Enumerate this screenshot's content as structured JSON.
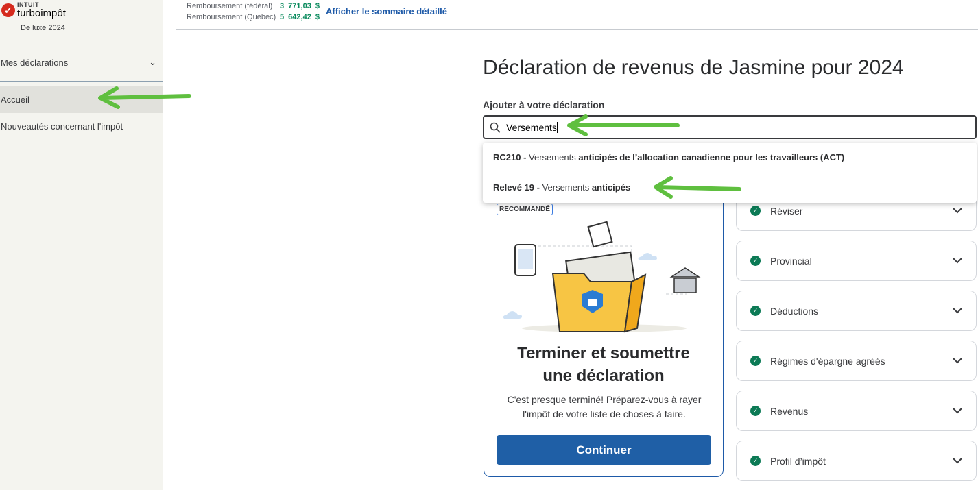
{
  "sidebar": {
    "logo_intuit": "INTUIT",
    "logo_brand": "turboimpôt",
    "edition": "De luxe 2024",
    "returns_menu": "Mes déclarations",
    "items": [
      {
        "label": "Accueil",
        "active": true
      },
      {
        "label": "Nouveautés concernant l'impôt"
      }
    ]
  },
  "header": {
    "refunds": [
      {
        "label": "Remboursement (fédéral)",
        "amount": "3 771,03 $"
      },
      {
        "label": "Remboursement (Québec)",
        "amount": "5 642,42 $"
      }
    ],
    "summary_link": "Afficher le sommaire détaillé"
  },
  "main": {
    "title": "Déclaration de revenus de Jasmine pour 2024",
    "add_label": "Ajouter à votre déclaration",
    "search_value": "Versements",
    "suggestions": [
      {
        "code": "RC210 -",
        "plain": "Versements",
        "bold": "anticipés de l’allocation canadienne pour les travailleurs (ACT)"
      },
      {
        "code": "Relevé 19 -",
        "plain": "Versements",
        "bold": "anticipés"
      }
    ],
    "card": {
      "badge": "RECOMMANDÉ",
      "title": "Terminer et soumettre une déclaration",
      "description": "C'est presque terminé! Préparez-vous à rayer l'impôt de votre liste de choses à faire.",
      "button": "Continuer"
    },
    "sections": [
      "Réviser",
      "Provincial",
      "Déductions",
      "Régimes d'épargne agréés",
      "Revenus",
      "Profil d’impôt"
    ]
  },
  "colors": {
    "accent": "#1f5fa6",
    "success": "#0b7a55",
    "annotation_arrow": "#5fbf3f"
  }
}
